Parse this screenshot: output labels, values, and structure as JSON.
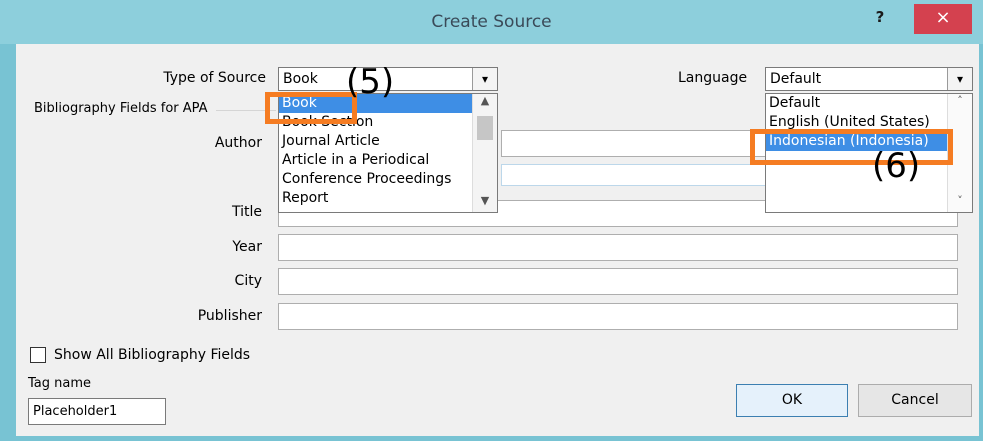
{
  "window": {
    "title": "Create Source",
    "help": "?",
    "close": "×"
  },
  "source": {
    "type_label": "Type of Source",
    "selected": "Book",
    "list": [
      "Book",
      "Book Section",
      "Journal Article",
      "Article in a Periodical",
      "Conference Proceedings",
      "Report"
    ]
  },
  "language": {
    "label": "Language",
    "selected": "Default",
    "list": [
      "Default",
      "English (United States)",
      "Indonesian (Indonesia)"
    ]
  },
  "fields": {
    "section_label": "Bibliography Fields for APA",
    "author": "Author",
    "title": "Title",
    "year": "Year",
    "city": "City",
    "publisher": "Publisher"
  },
  "show_all": "Show All Bibliography Fields",
  "tag": {
    "label": "Tag name",
    "value": "Placeholder1"
  },
  "buttons": {
    "ok": "OK",
    "cancel": "Cancel"
  },
  "annotations": {
    "five": "(5)",
    "six": "(6)"
  },
  "colors": {
    "highlight": "#f57c22",
    "selection": "#3e8ee5",
    "close": "#d4414f"
  }
}
